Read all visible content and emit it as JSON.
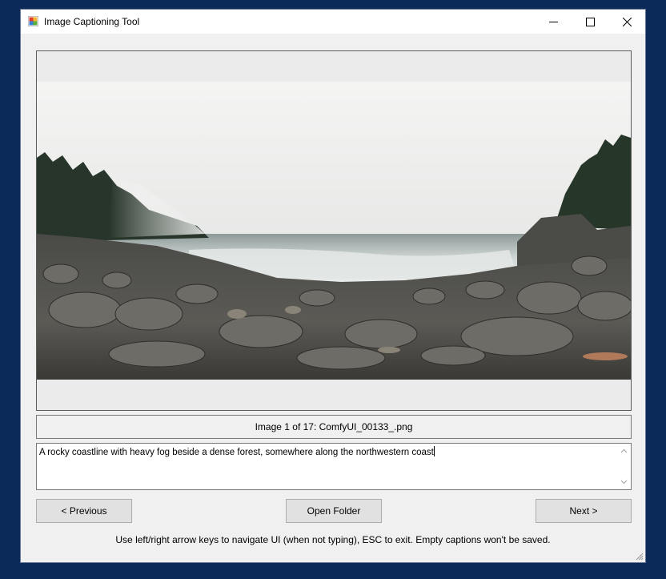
{
  "window": {
    "title": "Image Captioning Tool",
    "icon": "app-icon",
    "controls": [
      "minimize-icon",
      "maximize-icon",
      "close-icon"
    ]
  },
  "image_viewer": {
    "alt": "rocky coastline with fog and forest"
  },
  "status": {
    "text": "Image 1 of 17: ComfyUI_00133_.png"
  },
  "caption": {
    "value": "A rocky coastline with heavy fog beside a dense forest, somewhere along the northwestern coast"
  },
  "buttons": {
    "previous": "< Previous",
    "open_folder": "Open Folder",
    "next": "Next >"
  },
  "hint": {
    "text": "Use left/right arrow keys to navigate UI (when not typing), ESC to exit. Empty captions won't be saved."
  }
}
